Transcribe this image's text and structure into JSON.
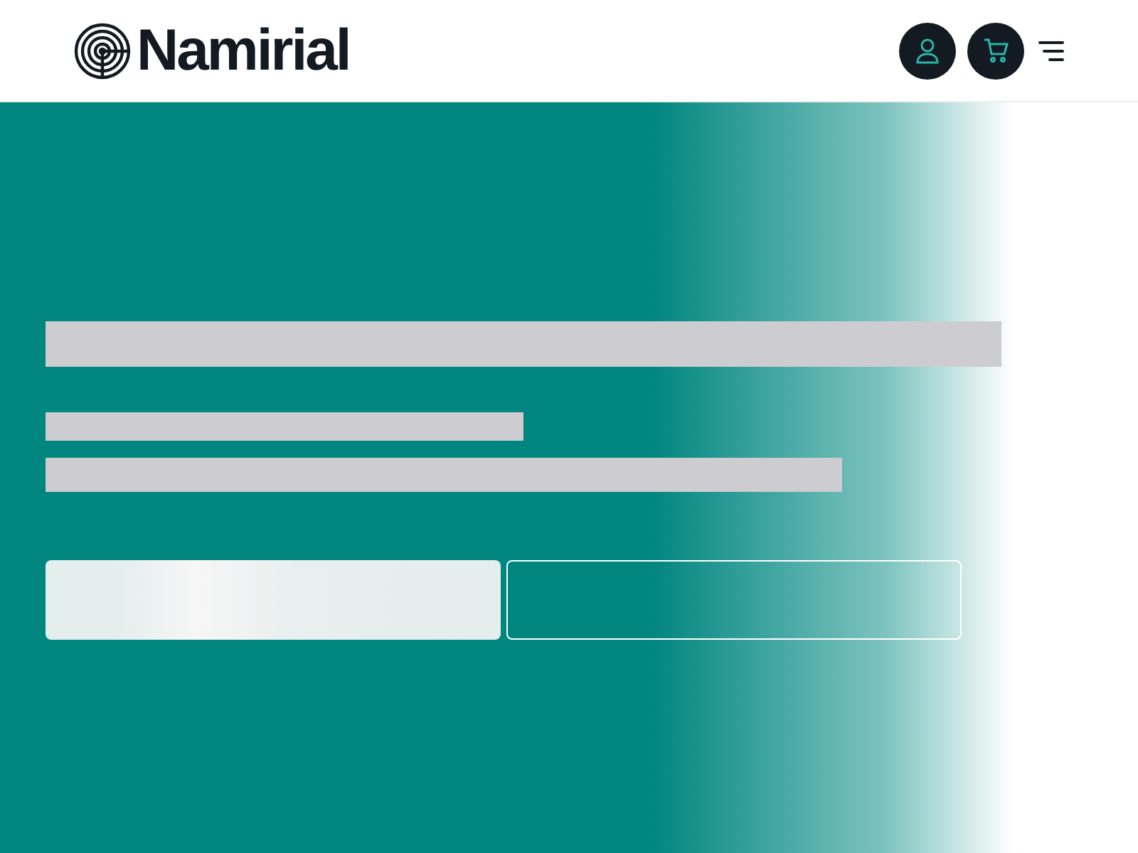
{
  "header": {
    "logo": "Namirial"
  },
  "hero": {
    "loading": true
  }
}
